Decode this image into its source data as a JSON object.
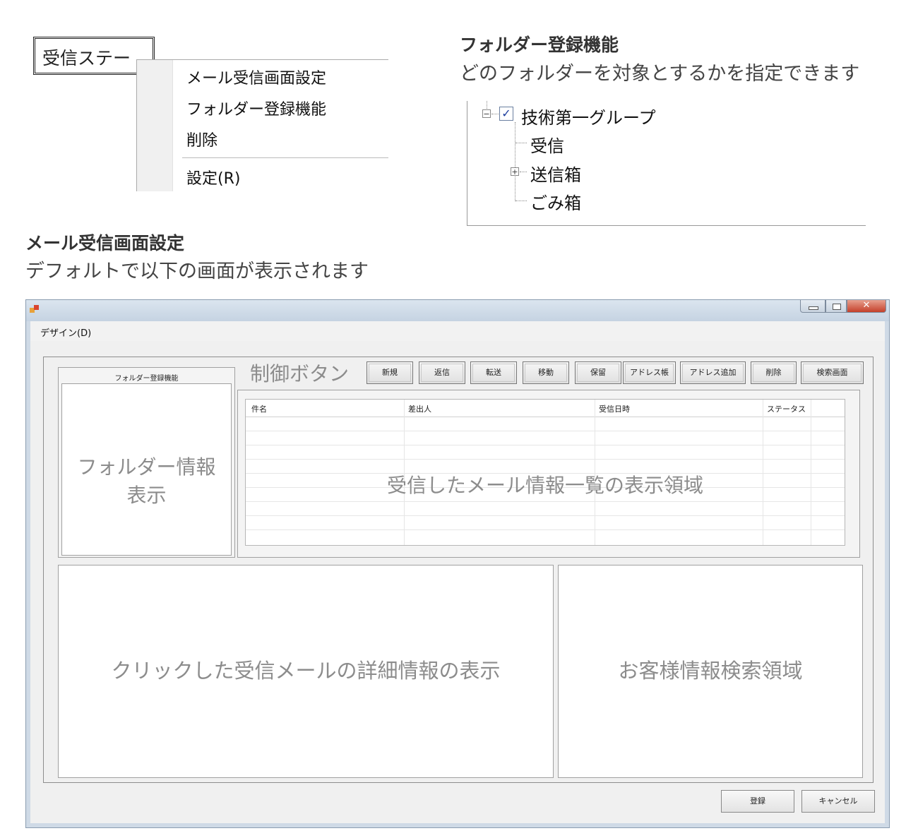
{
  "context_menu": {
    "trigger_label": "受信ステー",
    "items": [
      "メール受信画面設定",
      "フォルダー登録機能",
      "削除",
      "設定(R)"
    ]
  },
  "folder_section": {
    "title": "フォルダー登録機能",
    "description": "どのフォルダーを対象とするかを指定できます",
    "tree": {
      "root": {
        "label": "技術第一グループ",
        "checked": true,
        "expander": "−"
      },
      "children": [
        {
          "label": "受信",
          "expander": ""
        },
        {
          "label": "送信箱",
          "expander": "+"
        },
        {
          "label": "ごみ箱",
          "expander": ""
        }
      ]
    }
  },
  "mail_section": {
    "title": "メール受信画面設定",
    "description": "デフォルトで以下の画面が表示されます"
  },
  "window": {
    "menu_design": "デザイン(D)",
    "folder_group_caption": "フォルダー登録機能",
    "folder_area_line1": "フォルダー情報",
    "folder_area_line2": "表示",
    "control_label": "制御ボタン",
    "control_buttons": [
      "新規",
      "返信",
      "転送",
      "移動",
      "保留",
      "アドレス帳",
      "アドレス追加",
      "削除",
      "検索画面"
    ],
    "grid_columns": [
      "件名",
      "差出人",
      "受信日時",
      "ステータス"
    ],
    "mail_list_area": "受信したメール情報一覧の表示領域",
    "detail_area": "クリックした受信メールの詳細情報の表示",
    "customer_area": "お客様情報検索領域",
    "register_button": "登録",
    "cancel_button": "キャンセル"
  }
}
